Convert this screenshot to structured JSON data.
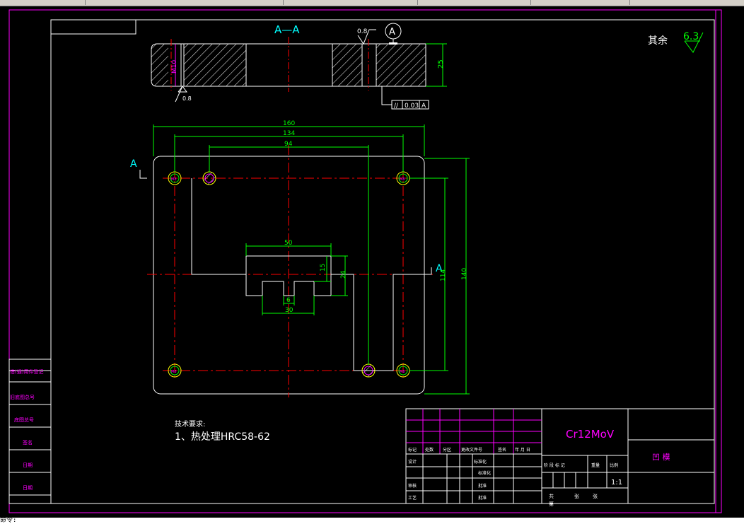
{
  "app": {
    "command_prompt": "命令:"
  },
  "colors": {
    "background": "#000000",
    "border": "#ff00ff",
    "outline": "#ffffff",
    "dimension": "#00ff00",
    "centerline": "#ff0000",
    "title_text": "#00ffff",
    "material_text": "#ff00ff",
    "hatch": "#ffffff"
  },
  "section": {
    "label": "A—A",
    "roughness_top": "0.8",
    "roughness_bottom": "0.8",
    "datum": "A",
    "thread": "M10",
    "thickness": "25",
    "tolerance_symbol": "//",
    "tolerance_value": "0.03",
    "tolerance_datum": "A"
  },
  "surface_note": {
    "label": "其余",
    "value": "6.3"
  },
  "plan": {
    "cut_marker_left": "A",
    "cut_marker_right": "A",
    "hole_label": "M8",
    "dims": {
      "width_overall": "160",
      "width_holes": "134",
      "width_pins": "94",
      "height_overall": "140",
      "height_holes": "114",
      "slot_width": "50",
      "slot_depth": "15",
      "slot_height": "24",
      "notch": "6",
      "notch_base": "30"
    }
  },
  "tech_requirements": {
    "title": "技术要求:",
    "item1": "1、热处理HRC58-62"
  },
  "title_block": {
    "material": "Cr12MoV",
    "part_name": "凹  模",
    "scale": "1:1",
    "row_labels": [
      "标记",
      "处数",
      "分区",
      "更改文件号",
      "签名",
      "年 月 日"
    ],
    "left_labels": [
      "设计",
      "审核",
      "工艺"
    ],
    "mid_labels": [
      "标准化",
      "批准"
    ],
    "stage_labels": [
      "阶 段 标 记",
      "重量",
      "比例"
    ],
    "sheet_labels": [
      "共",
      "张",
      "第",
      "张"
    ],
    "standardize": "标准化",
    "approve": "批准"
  },
  "side_table": {
    "labels": [
      "借(通)用件登记",
      "旧底图总号",
      "底图总号",
      "签名",
      "日期",
      "日期"
    ]
  }
}
